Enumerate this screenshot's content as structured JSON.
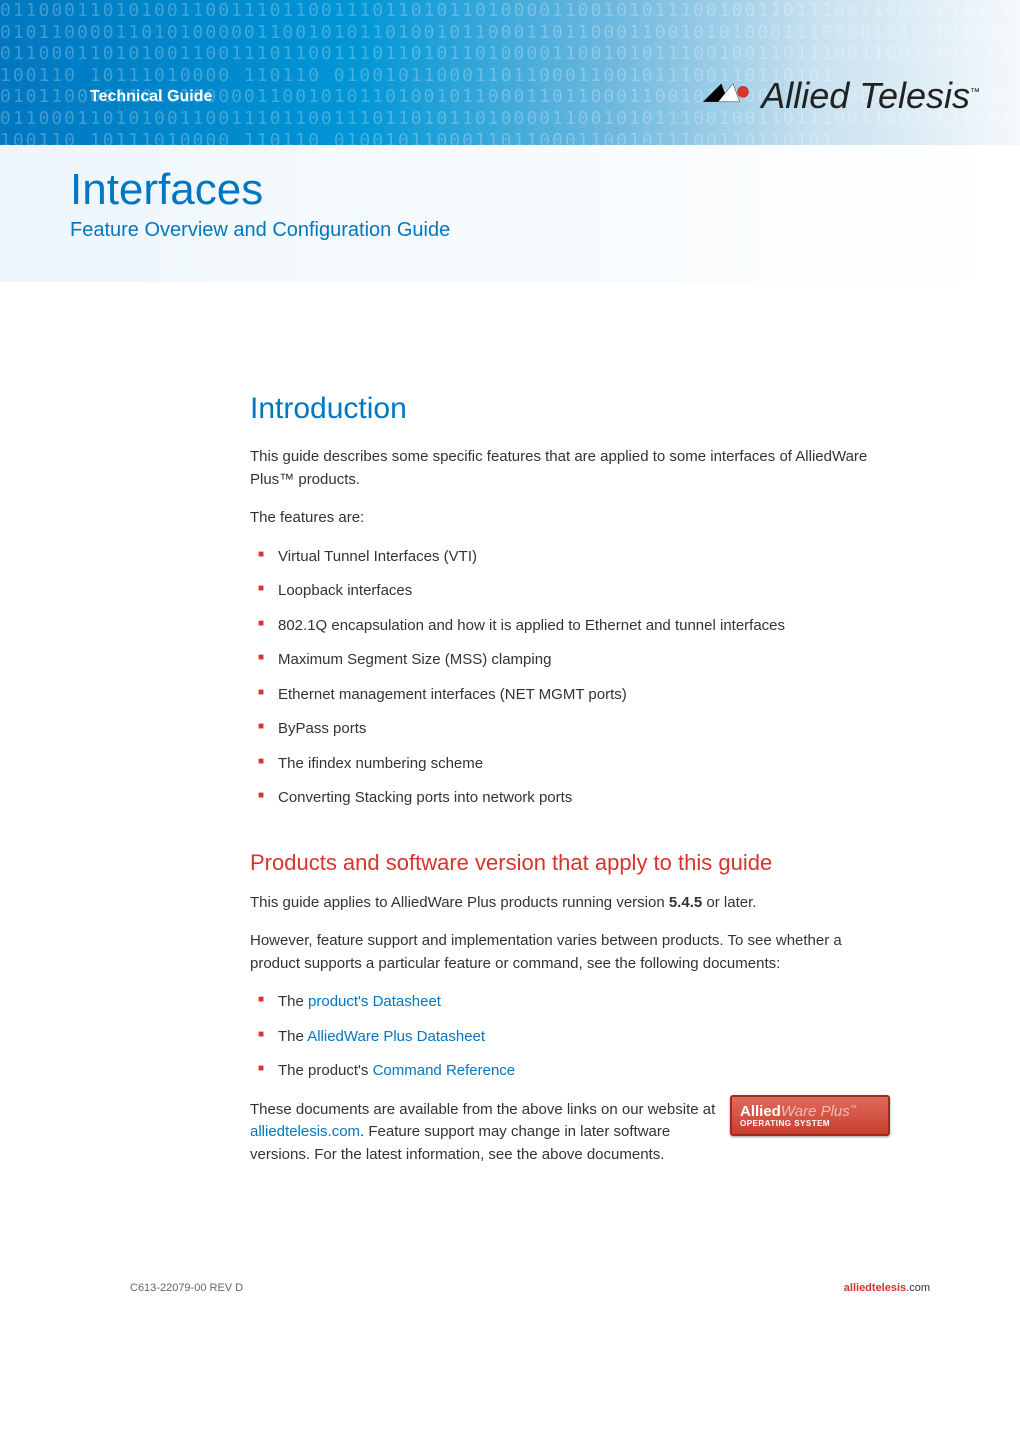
{
  "banner": {
    "tech_guide": "Technical Guide",
    "logo_text": "Allied Telesis",
    "logo_tm": "™",
    "binary": "011000110101001100111011001110110101101000011001010111001001101110011001101010111010000100",
    "binary2": "010110000110101000001100101011010010110001101100011001010100011100001010101010010101001",
    "binary3": "100110 10111010000 110110 010010110001101100011001011100110110101"
  },
  "title": {
    "main": "Interfaces",
    "sub": "Feature Overview and Configuration Guide"
  },
  "intro": {
    "heading": "Introduction",
    "para1": "This guide describes some specific features that are applied to some interfaces of AlliedWare Plus™ products.",
    "para2": "The features are:",
    "features": {
      "0": "Virtual Tunnel Interfaces (VTI)",
      "1": "Loopback interfaces",
      "2": "802.1Q encapsulation and how it is applied to Ethernet and tunnel interfaces",
      "3": "Maximum Segment Size (MSS) clamping",
      "4": "Ethernet management interfaces (NET MGMT ports)",
      "5": "ByPass ports",
      "6": "The ifindex numbering scheme",
      "7": "Converting Stacking ports into network ports"
    }
  },
  "products": {
    "heading": "Products and software version that apply to this guide",
    "para1_pre": "This guide applies to AlliedWare Plus products running version ",
    "para1_bold": "5.4.5",
    "para1_post": " or later.",
    "para2": "However, feature support and implementation varies between products. To see whether a product supports a particular feature or command, see the following documents:",
    "docs": {
      "0": {
        "pre": "The ",
        "link": "product's Datasheet"
      },
      "1": {
        "pre": "The ",
        "link": "AlliedWare Plus Datasheet"
      },
      "2": {
        "pre": "The product's ",
        "link": "Command Reference"
      }
    },
    "para3_pre": "These documents are available from the above links on our website at ",
    "para3_link": "alliedtelesis.com",
    "para3_post": ". Feature support may change in later software versions. For the latest information, see the above documents."
  },
  "badge": {
    "brand1": "Allied",
    "brand2": "Ware Plus",
    "tm": "™",
    "sub": "OPERATING SYSTEM"
  },
  "footer": {
    "left": "C613-22079-00 REV D",
    "right_bold": "alliedtelesis",
    "right_rest": ".com"
  }
}
